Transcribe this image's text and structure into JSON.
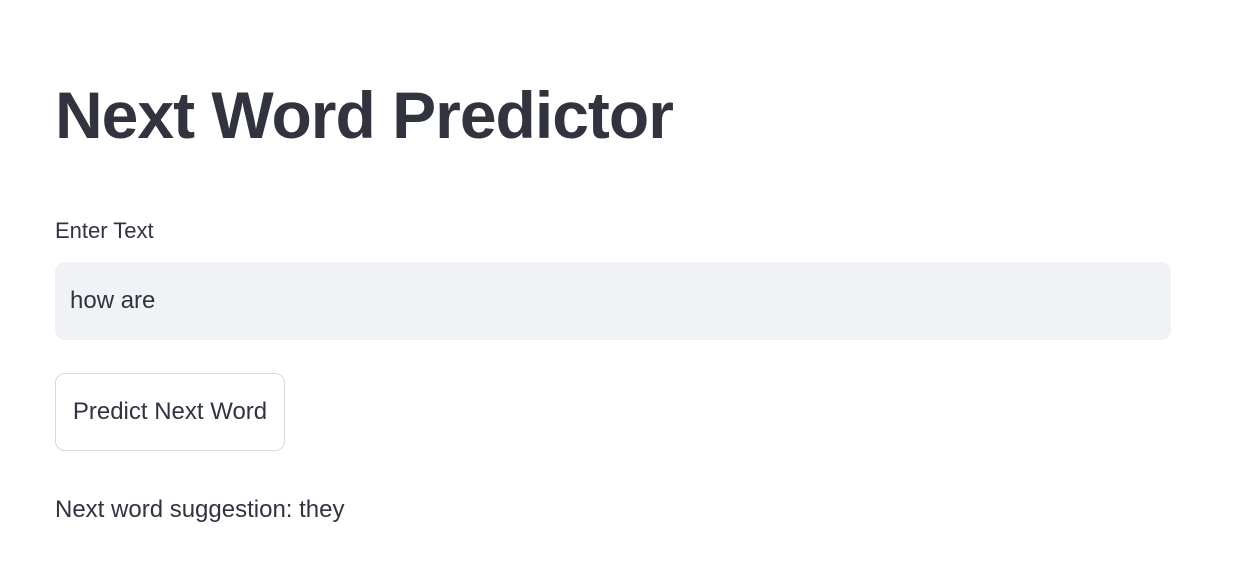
{
  "page": {
    "title": "Next Word Predictor"
  },
  "form": {
    "input_label": "Enter Text",
    "input_value": "how are",
    "predict_button_label": "Predict Next Word"
  },
  "result": {
    "text": "Next word suggestion: they"
  },
  "colors": {
    "text": "#31333f",
    "input_background": "#f0f2f6",
    "button_border": "#d6d8de",
    "page_background": "#ffffff"
  }
}
